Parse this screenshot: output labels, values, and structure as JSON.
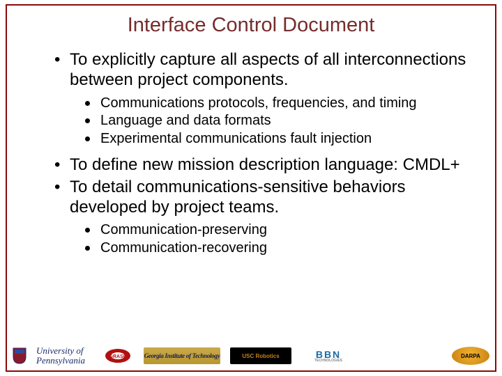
{
  "title": "Interface Control Document",
  "bullets": {
    "b1": "To explicitly capture all aspects of all interconnections between project components.",
    "b1_sub": {
      "s1": "Communications protocols, frequencies, and timing",
      "s2": "Language and data formats",
      "s3": "Experimental communications fault injection"
    },
    "b2": "To define new mission description language: CMDL+",
    "b3": "To detail communications-sensitive behaviors developed by project teams.",
    "b3_sub": {
      "s1": "Communication-preserving",
      "s2": "Communication-recovering"
    }
  },
  "footer": {
    "penn_line1": "University of",
    "penn_line2": "Pennsylvania",
    "grasp": "GRASP",
    "gatech": "Georgia Institute of Technology",
    "usc": "USC Robotics",
    "bbn_top": "BBN",
    "bbn_bot": "TECHNOLOGIES",
    "darpa": "DARPA"
  }
}
